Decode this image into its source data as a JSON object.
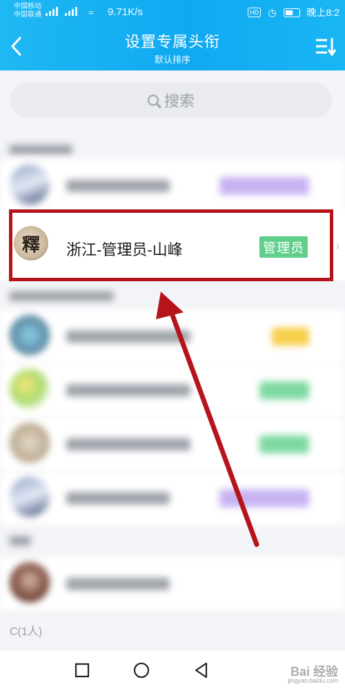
{
  "status_bar": {
    "carrier_1": "中国移动",
    "carrier_2": "中国联通",
    "net_speed": "9.71K/s",
    "hd": "HD",
    "time": "晚上8:2"
  },
  "header": {
    "title": "设置专属头衔",
    "subtitle": "默认排序",
    "back_icon": "chevron-left-icon",
    "sort_icon": "sort-list-icon"
  },
  "search": {
    "placeholder": "搜索"
  },
  "highlighted_member": {
    "avatar_char": "釋",
    "name": "浙江-管理员-山峰",
    "badge": "管理员",
    "badge_color": "#5fcf8a"
  },
  "section_c": {
    "label": "C(1人)"
  },
  "highlight_box_color": "#b4141a",
  "watermark": {
    "text": "Bai 经验",
    "sub": "jingyan.baidu.com"
  }
}
